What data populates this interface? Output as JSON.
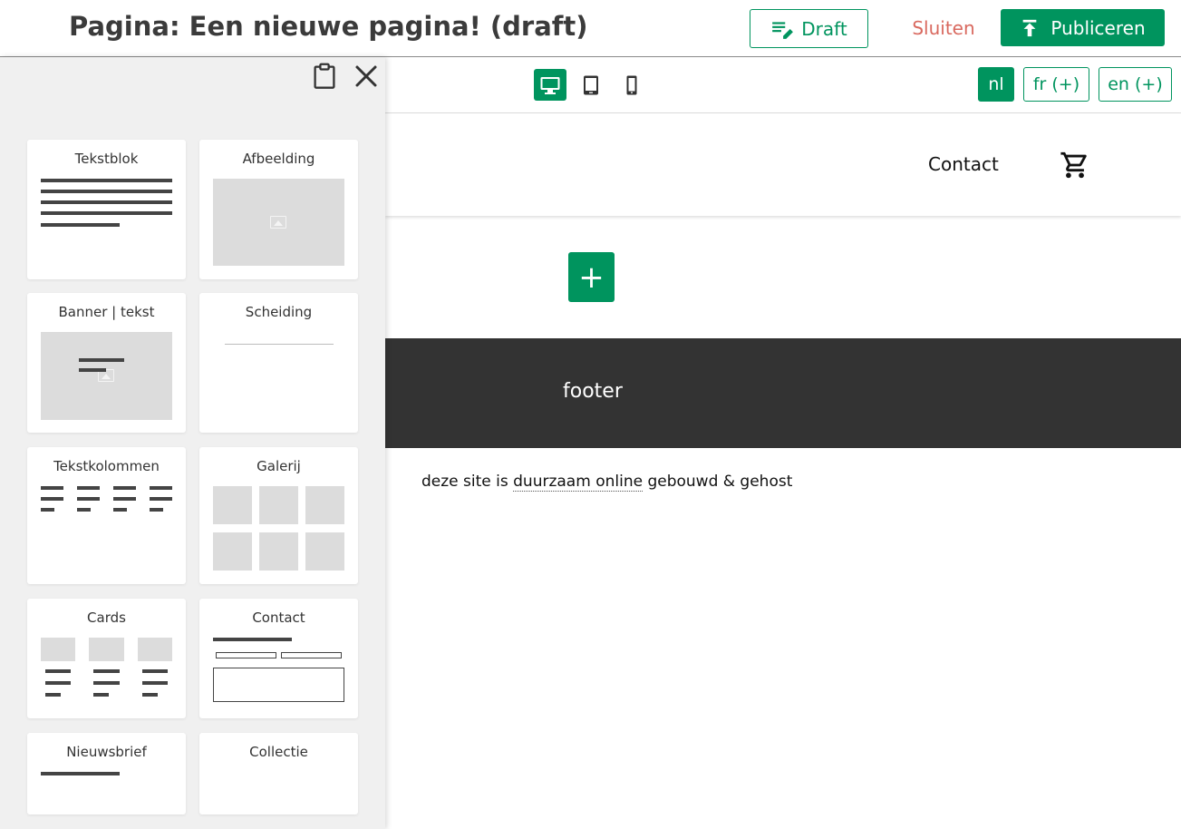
{
  "topbar": {
    "title": "Pagina: Een nieuwe pagina! (draft)",
    "draft_label": "Draft",
    "close_label": "Sluiten",
    "publish_label": "Publiceren"
  },
  "toolbar": {
    "devices": [
      {
        "name": "desktop",
        "icon": "desktop-icon",
        "active": true
      },
      {
        "name": "tablet",
        "icon": "tablet-icon",
        "active": false
      },
      {
        "name": "mobile",
        "icon": "mobile-icon",
        "active": false
      }
    ],
    "languages": [
      {
        "code": "nl",
        "label": "nl",
        "active": true
      },
      {
        "code": "fr",
        "label": "fr (+)",
        "active": false
      },
      {
        "code": "en",
        "label": "en (+)",
        "active": false
      }
    ]
  },
  "panel": {
    "blocks": [
      {
        "label": "Tekstblok"
      },
      {
        "label": "Afbeelding"
      },
      {
        "label": "Banner | tekst"
      },
      {
        "label": "Scheiding"
      },
      {
        "label": "Tekstkolommen"
      },
      {
        "label": "Galerij"
      },
      {
        "label": "Cards"
      },
      {
        "label": "Contact"
      },
      {
        "label": "Nieuwsbrief"
      },
      {
        "label": "Collectie"
      }
    ]
  },
  "site": {
    "nav_contact": "Contact",
    "add_label": "+",
    "footer_label": "footer",
    "credit_before": "deze site is ",
    "credit_link": "duurzaam online",
    "credit_after": " gebouwd & gehost"
  },
  "colors": {
    "accent": "#00945e",
    "danger": "#d9695f",
    "footer_bg": "#333333",
    "panel_bg": "#f0f0f0"
  }
}
